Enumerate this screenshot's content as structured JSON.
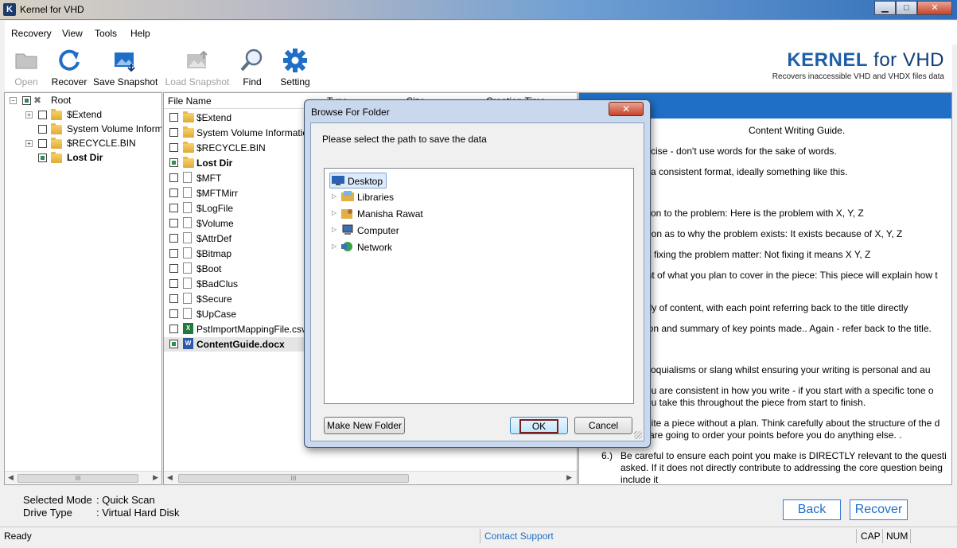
{
  "window": {
    "title": "Kernel for VHD",
    "app_icon": "K",
    "min": "▁",
    "max": "□",
    "close": "✕"
  },
  "menu": [
    "Recovery",
    "View",
    "Tools",
    "Help"
  ],
  "toolbar": {
    "items": [
      {
        "label": "Open",
        "icon": "folder-open-icon",
        "enabled": false
      },
      {
        "label": "Recover",
        "icon": "refresh-icon",
        "enabled": true
      },
      {
        "label": "Save Snapshot",
        "icon": "image-save-icon",
        "enabled": true
      },
      {
        "label": "Load Snapshot",
        "icon": "image-load-icon",
        "enabled": false
      },
      {
        "label": "Find",
        "icon": "magnifier-icon",
        "enabled": true
      },
      {
        "label": "Setting",
        "icon": "gear-icon",
        "enabled": true
      }
    ],
    "brand_bold": "KERNEL",
    "brand_rest": " for VHD",
    "tagline": "Recovers inaccessible VHD and VHDX files data"
  },
  "tree": {
    "root": "Root",
    "items": [
      "$Extend",
      "System Volume Inform",
      "$RECYCLE.BIN",
      "Lost Dir"
    ]
  },
  "files": {
    "columns": [
      "File Name",
      "Type",
      "Size",
      "Creation Time"
    ],
    "rows": [
      {
        "name": "$Extend",
        "kind": "folder",
        "checked": false,
        "bold": false
      },
      {
        "name": "System Volume Informatio",
        "kind": "folder",
        "checked": false,
        "bold": false
      },
      {
        "name": "$RECYCLE.BIN",
        "kind": "folder",
        "checked": false,
        "bold": false
      },
      {
        "name": "Lost Dir",
        "kind": "folder",
        "checked": true,
        "bold": true
      },
      {
        "name": "$MFT",
        "kind": "file",
        "checked": false,
        "bold": false
      },
      {
        "name": "$MFTMirr",
        "kind": "file",
        "checked": false,
        "bold": false
      },
      {
        "name": "$LogFile",
        "kind": "file",
        "checked": false,
        "bold": false
      },
      {
        "name": "$Volume",
        "kind": "file",
        "checked": false,
        "bold": false
      },
      {
        "name": "$AttrDef",
        "kind": "file",
        "checked": false,
        "bold": false
      },
      {
        "name": "$Bitmap",
        "kind": "file",
        "checked": false,
        "bold": false
      },
      {
        "name": "$Boot",
        "kind": "file",
        "checked": false,
        "bold": false
      },
      {
        "name": "$BadClus",
        "kind": "file",
        "checked": false,
        "bold": false
      },
      {
        "name": "$Secure",
        "kind": "file",
        "checked": false,
        "bold": false
      },
      {
        "name": "$UpCase",
        "kind": "file",
        "checked": false,
        "bold": false
      },
      {
        "name": "PstImportMappingFile.csv",
        "kind": "xls",
        "checked": false,
        "bold": false
      },
      {
        "name": "ContentGuide.docx",
        "kind": "doc",
        "checked": true,
        "bold": true
      }
    ],
    "scroll_left": "◀",
    "scroll_right": "▶",
    "scroll_grip": "III"
  },
  "preview": {
    "lines": [
      "Content Writing Guide.",
      "cise - don't use words for the sake of words.",
      "a consistent format, ideally something like this.",
      "ction to the problem: Here is the problem with X, Y, Z",
      "ation as to why the problem exists: It exists because of X, Y, Z",
      "es fixing the problem matter: Not fixing it means X Y, Z",
      "ent of what you plan to cover in the piece: This piece will explain how t",
      "ody of content, with each point referring back to the title directly",
      "sion and summary of key points made.. Again - refer back to the title.",
      "olloquialisms or slang whilst ensuring your writing is personal and au",
      "you are consistent in how you write - if you start with a specific tone o",
      "you take this throughout the piece from start to finish.",
      "write a piece without a plan. Think carefully about the structure of the d",
      "u are going to order your points before you do anything else. .",
      "6.)",
      "Be careful to ensure each point you make is DIRECTLY relevant to the questi",
      "asked. If it does not directly contribute to addressing the core question being",
      "include it"
    ]
  },
  "footer": {
    "mode_label": "Selected Mode",
    "mode_value": ": Quick Scan",
    "drive_label": "Drive Type",
    "drive_value": ": Virtual Hard Disk",
    "back": "Back",
    "recover": "Recover"
  },
  "status": {
    "ready": "Ready",
    "support": "Contact Support",
    "cap": "CAP",
    "num": "NUM"
  },
  "dialog": {
    "title": "Browse For Folder",
    "close": "✕",
    "prompt": "Please select the path to save the data",
    "tree": [
      {
        "label": "Desktop",
        "icon": "desktop-icon",
        "selected": true,
        "expander": ""
      },
      {
        "label": "Libraries",
        "icon": "libraries-icon",
        "selected": false,
        "expander": "▷"
      },
      {
        "label": "Manisha Rawat",
        "icon": "user-folder-icon",
        "selected": false,
        "expander": "▷"
      },
      {
        "label": "Computer",
        "icon": "computer-icon",
        "selected": false,
        "expander": "▷"
      },
      {
        "label": "Network",
        "icon": "network-icon",
        "selected": false,
        "expander": "▷"
      }
    ],
    "make_new_folder": "Make New Folder",
    "ok": "OK",
    "cancel": "Cancel"
  },
  "colors": {
    "accent": "#1f6fc7",
    "brand": "#1d5fa8",
    "check": "#2e8b57"
  }
}
